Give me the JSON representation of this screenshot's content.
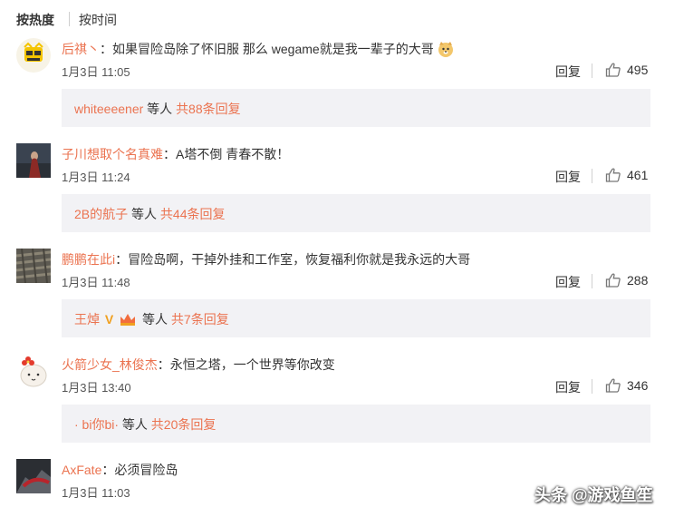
{
  "sort": {
    "hot": "按热度",
    "time": "按时间"
  },
  "labels": {
    "reply": "回复",
    "etc": "等人",
    "sep": "："
  },
  "colors": {
    "username": "#eb7350",
    "reply_bg": "#f2f2f5",
    "text": "#333333"
  },
  "comments": [
    {
      "user": "后祺丶",
      "text": "如果冒险岛除了怀旧服 那么 wegame就是我一辈子的大哥",
      "emoji": "doge-emoji",
      "time": "1月3日 11:05",
      "likes": "495",
      "reply_user": "whiteeeener",
      "reply_total": "共88条回复"
    },
    {
      "user": "子川想取个名真难",
      "text": "A塔不倒 青春不散！",
      "time": "1月3日 11:24",
      "likes": "461",
      "reply_user": "2B的航子",
      "reply_total": "共44条回复"
    },
    {
      "user": "鹏鹏在此i",
      "text": "冒险岛啊，干掉外挂和工作室，恢复福利你就是我永远的大哥",
      "time": "1月3日 11:48",
      "likes": "288",
      "reply_user": "王焯",
      "reply_total": "共7条回复"
    },
    {
      "user": "火箭少女_林俊杰",
      "text": "永恒之塔，一个世界等你改变",
      "time": "1月3日 13:40",
      "likes": "346",
      "reply_user": "· bi你bi·",
      "reply_total": "共20条回复"
    },
    {
      "user": "AxFate",
      "text": "必须冒险岛",
      "time": "1月3日 11:03"
    }
  ],
  "watermark": "头条 @游戏鱼笙"
}
